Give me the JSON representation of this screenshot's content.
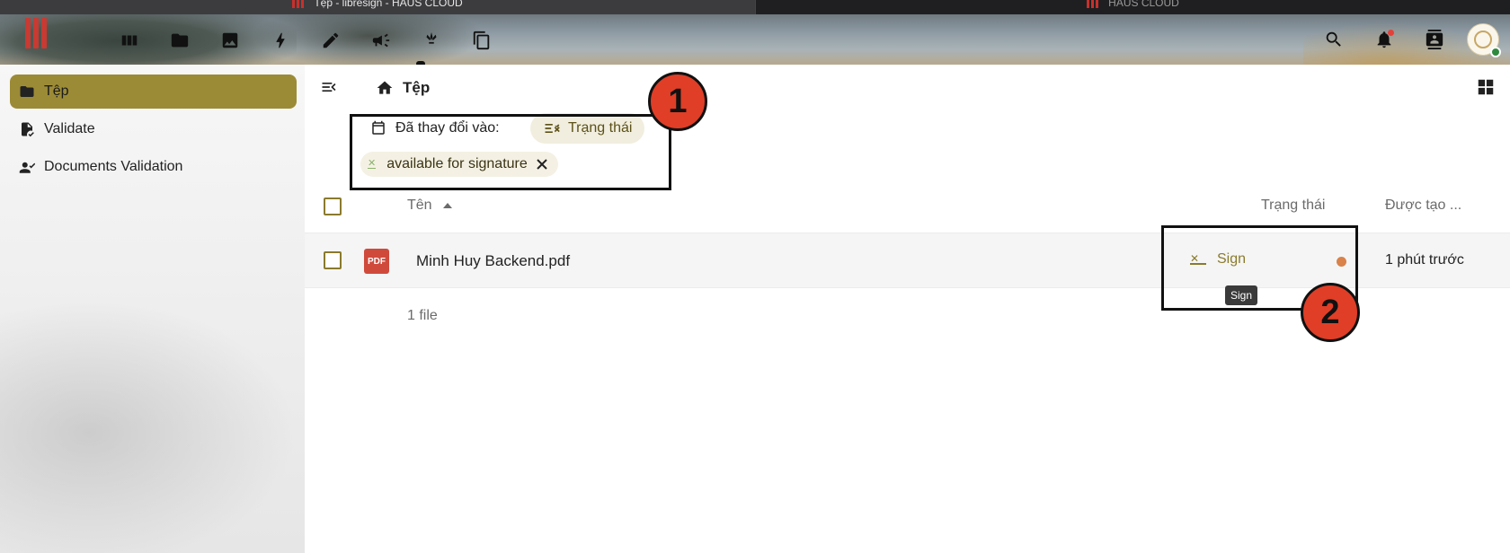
{
  "browser": {
    "active_tab_title": "Tệp - libresign - HAUS CLOUD",
    "inactive_tab_title": "HAUS CLOUD"
  },
  "header": {
    "apps": [
      {
        "icon": "dashboard-icon"
      },
      {
        "icon": "files-icon"
      },
      {
        "icon": "photos-icon"
      },
      {
        "icon": "activity-icon"
      },
      {
        "icon": "notes-icon"
      },
      {
        "icon": "announcements-icon"
      },
      {
        "icon": "libresign-icon"
      },
      {
        "icon": "documents-icon"
      }
    ],
    "right_icons": [
      "search-icon",
      "notifications-icon",
      "contacts-icon"
    ]
  },
  "sidebar": {
    "items": [
      {
        "label": "Tệp",
        "icon": "folder-icon",
        "active": true
      },
      {
        "label": "Validate",
        "icon": "file-check-icon",
        "active": false
      },
      {
        "label": "Documents Validation",
        "icon": "account-check-icon",
        "active": false
      }
    ]
  },
  "main": {
    "breadcrumb": "Tệp",
    "filters": {
      "changed_label": "Đã thay đổi vào:",
      "status_label": "Trạng thái",
      "active_chip": "available for signature"
    },
    "table": {
      "headers": {
        "name": "Tên",
        "status": "Trạng thái",
        "created": "Được tạo ..."
      },
      "rows": [
        {
          "filename": "Minh Huy Backend.pdf",
          "file_type": "PDF",
          "status": "Sign",
          "created": "1 phút trước"
        }
      ],
      "summary": "1 file"
    },
    "tooltip": "Sign"
  },
  "annotations": {
    "badge1": "1",
    "badge2": "2"
  },
  "colors": {
    "primary": "#9c8b36",
    "badge": "#e03e27",
    "pdf": "#d04a3c",
    "status_dot": "#d9824a"
  }
}
